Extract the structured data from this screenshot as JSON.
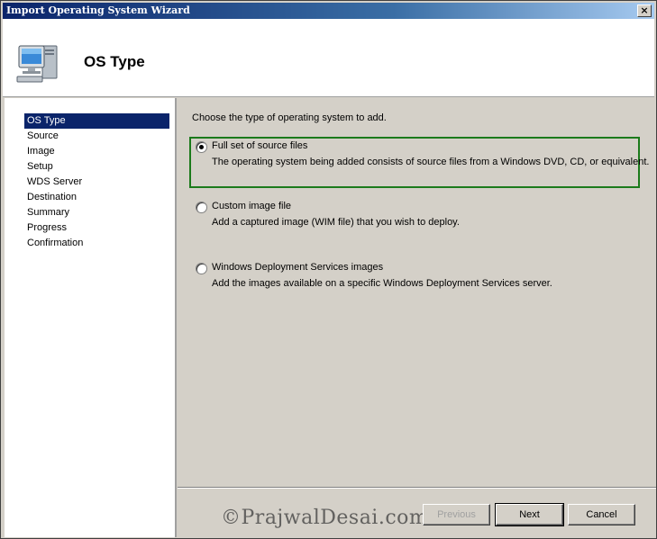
{
  "window": {
    "title": "Import Operating System Wizard",
    "close_glyph": "×"
  },
  "header": {
    "title": "OS Type",
    "icon": "computer-monitor-icon"
  },
  "sidebar": {
    "steps": [
      "OS Type",
      "Source",
      "Image",
      "Setup",
      "WDS Server",
      "Destination",
      "Summary",
      "Progress",
      "Confirmation"
    ],
    "active_index": 0
  },
  "main": {
    "instruction": "Choose the type of operating system to add.",
    "options": [
      {
        "label": "Full set of source files",
        "description": "The operating system being added consists of source files from a Windows DVD, CD, or equivalent.",
        "selected": true
      },
      {
        "label": "Custom image file",
        "description": "Add a captured image (WIM file) that you wish to deploy.",
        "selected": false
      },
      {
        "label": "Windows Deployment Services images",
        "description": "Add the images available on a specific Windows Deployment Services server.",
        "selected": false
      }
    ]
  },
  "buttons": {
    "previous": "Previous",
    "next": "Next",
    "cancel": "Cancel"
  },
  "watermark": "©PrajwalDesai.com",
  "colors": {
    "highlight_border": "#1b7a1b",
    "selection_bg": "#0a246a",
    "titlebar": "#0a246a"
  }
}
